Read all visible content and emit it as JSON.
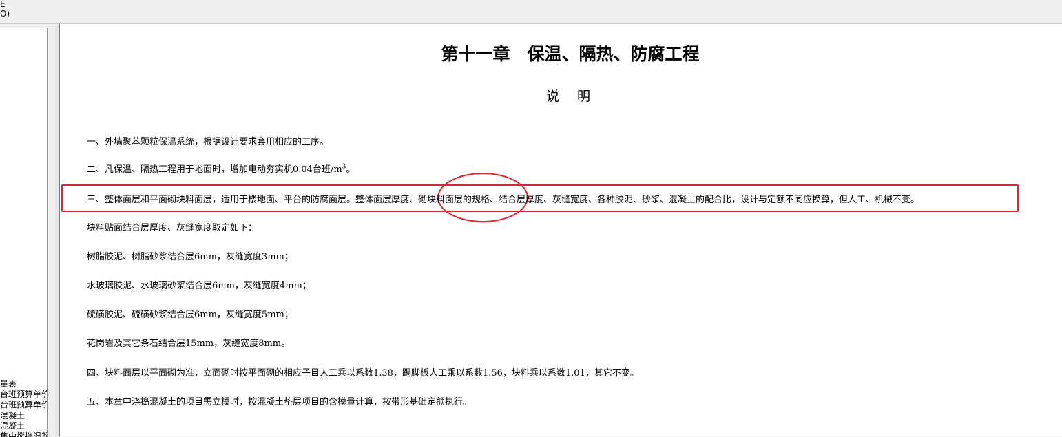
{
  "menu": {
    "fragment_top": "E",
    "fragment_bottom": "O)"
  },
  "tree": {
    "items": [
      "量表",
      "台班预算单价",
      "台班预算单价",
      "混凝土",
      "混凝土",
      "集中搅拌混凝"
    ]
  },
  "document": {
    "chapter_title": "第十一章　保温、隔热、防腐工程",
    "subtitle": "说明",
    "paragraphs": [
      "一、外墙聚苯颗粒保温系统，根据设计要求套用相应的工序。",
      "二、凡保温、隔热工程用于地面时，增加电动夯实机0.04台班/m",
      "三、整体面层和平面砌块料面层，适用于楼地面、平台的防腐面层。整体面层厚度、砌块料面层的规格、结合层厚度、灰缝宽度、各种胶泥、砂浆、混凝土的配合比，设计与定额不同应换算，但人工、机械不变。",
      "块料贴面结合层厚度、灰缝宽度取定如下：",
      "树脂胶泥、树脂砂浆结合层6mm，灰缝宽度3mm；",
      "水玻璃胶泥、水玻璃砂浆结合层6mm，灰缝宽度4mm；",
      "硫磺胶泥、硫磺砂浆结合层6mm，灰缝宽度5mm；",
      "花岗岩及其它条石结合层15mm，灰缝宽度8mm。",
      "四、块料面层以平面砌为准，立面砌时按平面砌的相应子目人工乘以系数1.38，踢脚板人工乘以系数1.56，块料乘以系数1.01，其它不变。",
      "五、本章中浇捣混凝土的项目需立模时，按混凝土垫层项目的含模量计算，按带形基础定额执行。"
    ],
    "p2_sup": "3",
    "p2_end": "。"
  },
  "highlight_color": "#e8202a"
}
